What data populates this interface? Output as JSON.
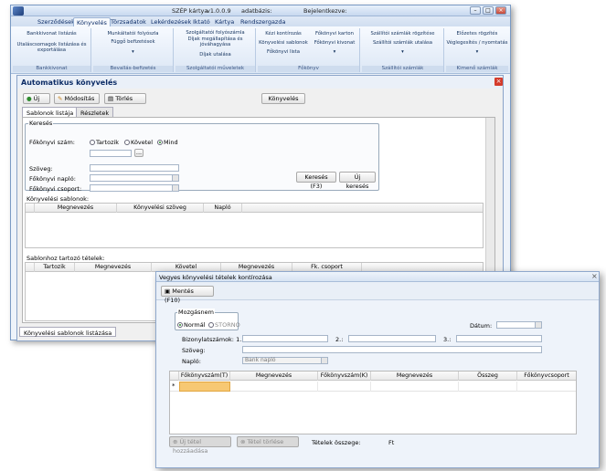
{
  "app": {
    "title_left": "SZÉP kártya",
    "version": "v1.0.0.9",
    "db_label": "adatbázis:",
    "login_label": "Bejelentkezve:"
  },
  "ribbon_tabs": [
    "Szerződések",
    "Könyvelés",
    "Törzsadatok",
    "Lekérdezések",
    "Iktató",
    "Kártya",
    "Rendszergazda"
  ],
  "ribbon_groups": [
    {
      "items": [
        "Bankkivonat listázás",
        "Utaláscsomagok listázása és exportálása"
      ],
      "label": "Bankkivonat"
    },
    {
      "items": [
        "Munkáltatói folyószla",
        "Függő befizetések",
        "▾"
      ],
      "label": "Bevallás-befizetés"
    },
    {
      "items": [
        "Szolgáltatói folyószámla",
        "Díjak megállapítása és jóváhagyása",
        "Díjak utalása"
      ],
      "label": "Szolgáltatói műveletek"
    },
    {
      "items": [
        "Kézi kontírozás",
        "Könyvelési sablonok",
        "Főkönyvi lista",
        "Főkönyvi karton",
        "Főkönyvi kivonat",
        "▾"
      ],
      "label": "Főkönyv"
    },
    {
      "items": [
        "Szállítói számlák rögzítése",
        "Szállítói számlák utalása",
        "▾"
      ],
      "label": "Szállítói számlák"
    },
    {
      "items": [
        "Előzetes rögzítés",
        "Véglegesítés / nyomtatás",
        "▾"
      ],
      "label": "Kimenő számlák"
    }
  ],
  "auto": {
    "title": "Automatikus könyvelés",
    "btn_new": "Új",
    "btn_edit": "Módosítás",
    "btn_delete": "Törlés",
    "btn_book": "Könyvelés",
    "tab_list": "Sablonok listája",
    "tab_detail": "Részletek",
    "search_group": "Keresés",
    "account_label": "Főkönyvi szám:",
    "radio_debit": "Tartozik",
    "radio_credit": "Követel",
    "radio_all": "Mind",
    "browse": "...",
    "text_label": "Szöveg:",
    "journal_label": "Főkönyvi napló:",
    "group_label": "Főkönyvi csoport:",
    "search_btn": "Keresés (F3)",
    "new_search_btn": "Új keresés",
    "templates_label": "Könyvelési sablonok:",
    "templates_cols": [
      "Megnevezés",
      "Könyvelési szöveg",
      "Napló"
    ],
    "items_label": "Sablonhoz tartozó tételek:",
    "items_cols": [
      "Tartozik",
      "Megnevezés",
      "Követel",
      "Megnevezés",
      "Fk. csoport"
    ],
    "bottom_tab": "Könyvelési sablonok listázása"
  },
  "mixed": {
    "title": "Vegyes könyvelési tételek kontírozása",
    "save_btn": "Mentés (F10)",
    "movement_group": "Mozgásnem",
    "radio_normal": "Normál",
    "radio_storno": "STORNO",
    "date_label": "Dátum:",
    "doc_numbers_label": "Bizonylatszámok: 1.:",
    "doc2_label": "2.:",
    "doc3_label": "3.:",
    "text_label": "Szöveg:",
    "journal_label": "Napló:",
    "journal_value": "Bank napló",
    "grid_cols": [
      "Főkönyvszám(T)",
      "Megnevezés",
      "Főkönyvszám(K)",
      "Megnevezés",
      "Összeg",
      "Főkönyvcsoport"
    ],
    "new_row_marker": "*",
    "add_btn": "Új tétel hozzáadása",
    "delete_btn": "Tétel törlése",
    "total_label": "Tételek összege:",
    "total_unit": "Ft"
  },
  "colors": {
    "accent": "#2b5797",
    "ribbon": "#dce7f5",
    "row_highlight": "#f7c873"
  }
}
